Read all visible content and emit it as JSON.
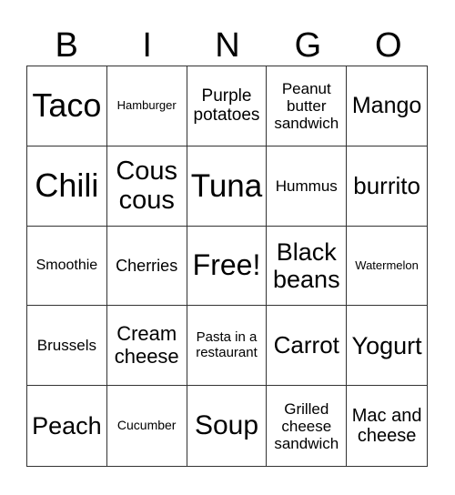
{
  "header": [
    "B",
    "I",
    "N",
    "G",
    "O"
  ],
  "cells": [
    "Taco",
    "Hamburger",
    "Purple potatoes",
    "Peanut butter sandwich",
    "Mango",
    "Chili",
    "Cous cous",
    "Tuna",
    "Hummus",
    "burrito",
    "Smoothie",
    "Cherries",
    "Free!",
    "Black beans",
    "Watermelon",
    "Brussels",
    "Cream cheese",
    "Pasta in a restaurant",
    "Carrot",
    "Yogurt",
    "Peach",
    "Cucumber",
    "Soup",
    "Grilled cheese sandwich",
    "Mac and cheese"
  ]
}
